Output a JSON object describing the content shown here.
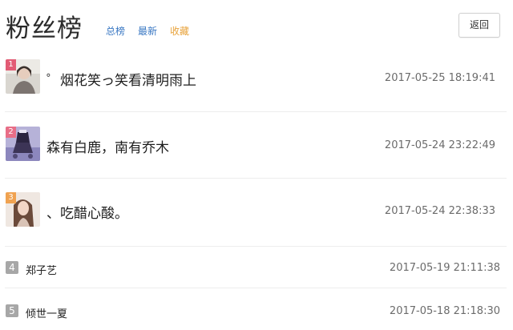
{
  "header": {
    "title": "粉丝榜",
    "tabs": [
      "总榜",
      "最新",
      "收藏"
    ],
    "back_label": "返回"
  },
  "fans": [
    {
      "rank": "1",
      "name": "゜烟花笑っ笑看清明雨上",
      "date": "2017-05-25 18:19:41"
    },
    {
      "rank": "2",
      "name": "森有白鹿，南有乔木",
      "date": "2017-05-24 23:22:49"
    },
    {
      "rank": "3",
      "name": "、吃醋心酸。",
      "date": "2017-05-24 22:38:33"
    },
    {
      "rank": "4",
      "name": "郑子艺",
      "date": "2017-05-19 21:11:38"
    },
    {
      "rank": "5",
      "name": "倾世一夏",
      "date": "2017-05-18 21:18:30"
    }
  ],
  "colors": {
    "tab_blue": "#3a78c3",
    "tab_orange": "#e8a33c",
    "badge_1": "#e25b74",
    "badge_2": "#e86e87",
    "badge_3": "#f0a250",
    "badge_gray": "#a7a7a7"
  }
}
